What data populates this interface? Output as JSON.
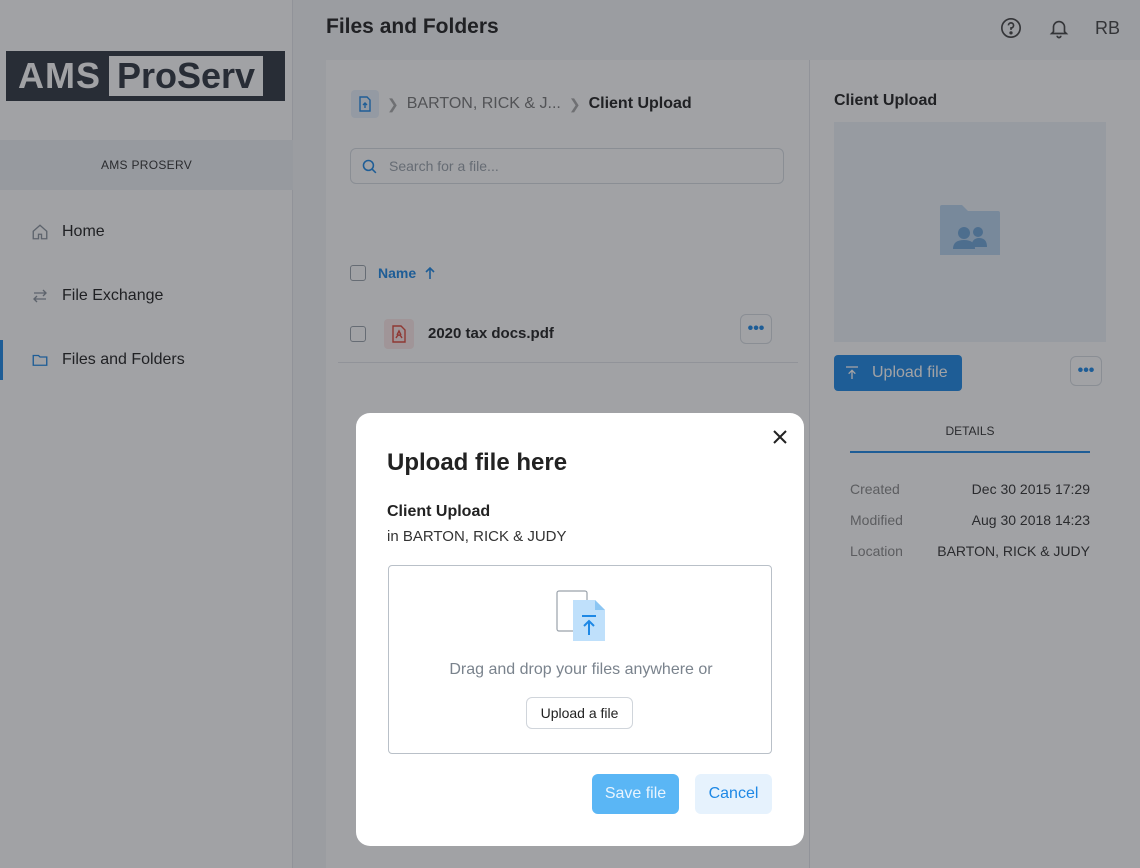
{
  "sidebar": {
    "logo": {
      "part1": "AMS",
      "part2": "ProServ"
    },
    "org_name": "AMS PROSERV",
    "items": [
      {
        "label": "Home",
        "icon": "home-icon"
      },
      {
        "label": "File Exchange",
        "icon": "exchange-icon"
      },
      {
        "label": "Files and Folders",
        "icon": "folder-icon",
        "active": true
      }
    ]
  },
  "header": {
    "title": "Files and Folders",
    "user_initials": "RB",
    "icons": [
      "help-icon",
      "bell-icon"
    ]
  },
  "main": {
    "breadcrumb": {
      "parent": "BARTON, RICK & J...",
      "current": "Client Upload"
    },
    "search": {
      "placeholder": "Search for a file...",
      "value": ""
    },
    "column_header": "Name",
    "files": [
      {
        "name": "2020 tax docs.pdf",
        "type": "pdf"
      }
    ]
  },
  "details_panel": {
    "title": "Client Upload",
    "upload_label": "Upload file",
    "tab": "DETAILS",
    "rows": [
      {
        "label": "Created",
        "value": "Dec 30 2015 17:29"
      },
      {
        "label": "Modified",
        "value": "Aug 30 2018 14:23"
      },
      {
        "label": "Location",
        "value": "BARTON, RICK & JUDY"
      }
    ]
  },
  "modal": {
    "title": "Upload file here",
    "folder_name": "Client Upload",
    "location": "in BARTON, RICK & JUDY",
    "drop_text": "Drag and drop your files anywhere or",
    "upload_button": "Upload a file",
    "save_label": "Save file",
    "cancel_label": "Cancel"
  },
  "colors": {
    "accent": "#1e88e5",
    "save_button": "#5ab6f5",
    "overlay": "rgba(30,34,40,0.42)"
  }
}
